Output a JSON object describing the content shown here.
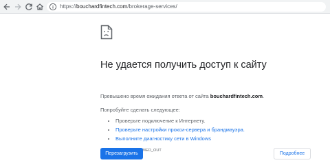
{
  "toolbar": {
    "url_scheme": "https://",
    "url_host": "bouchardfintech.com",
    "url_path": "/brokerage-services/",
    "icons": [
      "arrow-left",
      "arrow-right",
      "reload",
      "home",
      "info-circle"
    ]
  },
  "error": {
    "icon": "sad-document",
    "title": "Не удается получить доступ к сайту",
    "summary_prefix": "Превышено время ожидания ответа от сайта ",
    "summary_host": "bouchardfintech.com",
    "summary_suffix": ".",
    "try_title": "Попробуйте сделать следующее:",
    "suggestions": [
      "Проверьте подключение к Интернету.",
      "Проверьте настройки прокси-сервера и брандмауэра.",
      "Выполните диагностику сети в Windows"
    ],
    "error_code": "ERR_CONNECTION_TIMED_OUT"
  },
  "buttons": {
    "reload_label": "Перезагрузить",
    "details_label": "Подробнее"
  },
  "colors": {
    "link": "#1a73e8",
    "primary_button": "#1a73e8",
    "text": "#202124",
    "secondary_text": "#5f6368"
  }
}
